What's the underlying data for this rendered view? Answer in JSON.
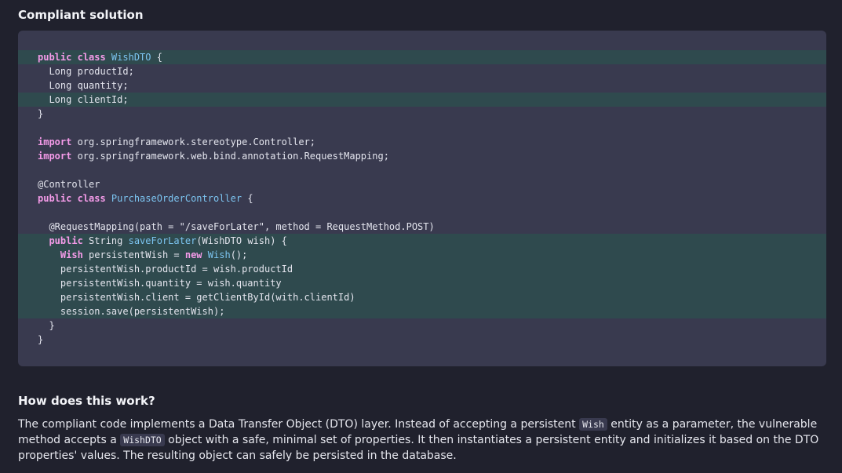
{
  "headings": {
    "compliant": "Compliant solution",
    "how": "How does this work?"
  },
  "code_lines": [
    {
      "hl": true,
      "parts": [
        {
          "t": "public class ",
          "c": "kw"
        },
        {
          "t": "WishDTO",
          "c": "cls"
        },
        {
          "t": " {"
        }
      ]
    },
    {
      "hl": false,
      "parts": [
        {
          "t": "  Long productId;"
        }
      ]
    },
    {
      "hl": false,
      "parts": [
        {
          "t": "  Long quantity;"
        }
      ]
    },
    {
      "hl": true,
      "parts": [
        {
          "t": "  Long clientId;"
        }
      ]
    },
    {
      "hl": false,
      "parts": [
        {
          "t": "}"
        }
      ]
    },
    {
      "hl": false,
      "parts": [
        {
          "t": ""
        }
      ]
    },
    {
      "hl": false,
      "parts": [
        {
          "t": "import ",
          "c": "kw"
        },
        {
          "t": "org.springframework.stereotype.Controller;"
        }
      ]
    },
    {
      "hl": false,
      "parts": [
        {
          "t": "import ",
          "c": "kw"
        },
        {
          "t": "org.springframework.web.bind.annotation.RequestMapping;"
        }
      ]
    },
    {
      "hl": false,
      "parts": [
        {
          "t": ""
        }
      ]
    },
    {
      "hl": false,
      "parts": [
        {
          "t": "@Controller"
        }
      ]
    },
    {
      "hl": false,
      "parts": [
        {
          "t": "public class ",
          "c": "kw"
        },
        {
          "t": "PurchaseOrderController",
          "c": "cls"
        },
        {
          "t": " {"
        }
      ]
    },
    {
      "hl": false,
      "parts": [
        {
          "t": ""
        }
      ]
    },
    {
      "hl": false,
      "parts": [
        {
          "t": "  @RequestMapping(path = \"/saveForLater\", method = RequestMethod.POST)"
        }
      ]
    },
    {
      "hl": true,
      "parts": [
        {
          "t": "  "
        },
        {
          "t": "public",
          "c": "kw"
        },
        {
          "t": " String "
        },
        {
          "t": "saveForLater",
          "c": "cls"
        },
        {
          "t": "(WishDTO wish) {"
        }
      ]
    },
    {
      "hl": true,
      "parts": [
        {
          "t": "    "
        },
        {
          "t": "Wish",
          "c": "kw"
        },
        {
          "t": " persistentWish = "
        },
        {
          "t": "new",
          "c": "kw"
        },
        {
          "t": " "
        },
        {
          "t": "Wish",
          "c": "cls"
        },
        {
          "t": "();"
        }
      ]
    },
    {
      "hl": true,
      "parts": [
        {
          "t": "    persistentWish.productId = wish.productId"
        }
      ]
    },
    {
      "hl": true,
      "parts": [
        {
          "t": "    persistentWish.quantity = wish.quantity"
        }
      ]
    },
    {
      "hl": true,
      "parts": [
        {
          "t": "    persistentWish.client = getClientById(with.clientId)"
        }
      ]
    },
    {
      "hl": true,
      "parts": [
        {
          "t": "    session.save(persistentWish);"
        }
      ]
    },
    {
      "hl": false,
      "parts": [
        {
          "t": "  }"
        }
      ]
    },
    {
      "hl": false,
      "parts": [
        {
          "t": "}"
        }
      ]
    }
  ],
  "description": {
    "line1_a": "The compliant code implements a Data Transfer Object (DTO) layer. Instead of accepting a persistent ",
    "code1": "Wish",
    "line1_b": " entity as a parameter, the vulnerable method accepts a ",
    "code2": "WishDTO",
    "line1_c": " object with a safe, minimal set of properties. It then instantiates a persistent entity and initializes it based on the DTO properties' values. The resulting object can safely be persisted in the database."
  }
}
